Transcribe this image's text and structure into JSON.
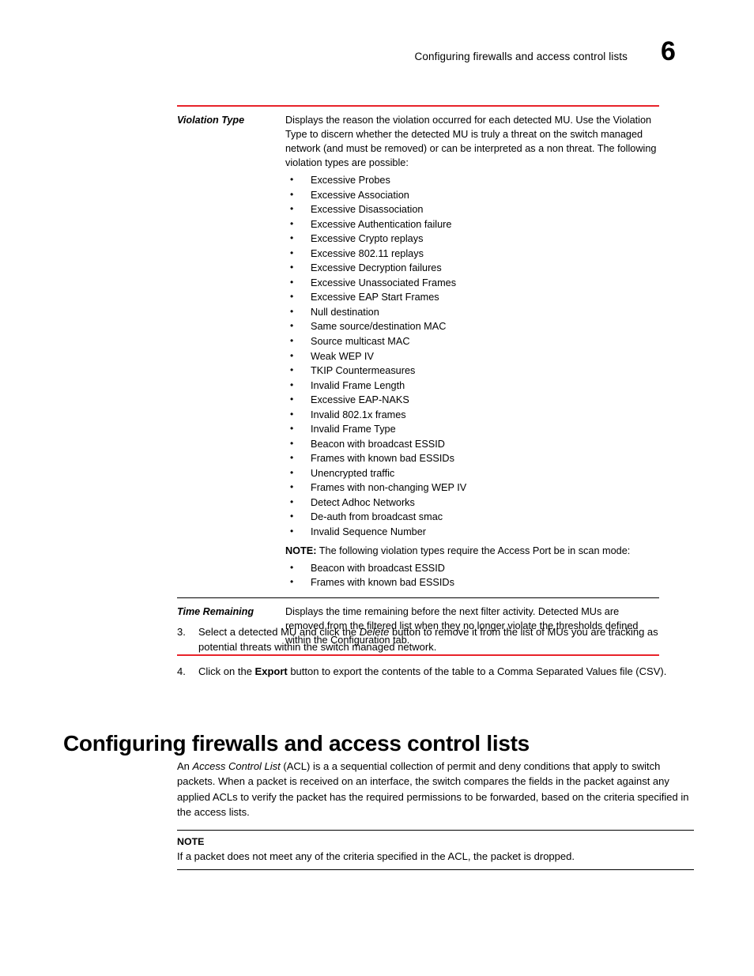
{
  "header": {
    "title": "Configuring firewalls and access control lists",
    "page_number": "6"
  },
  "definition_table": {
    "rows": [
      {
        "term": "Violation Type",
        "description": "Displays the reason the violation occurred for each detected MU. Use the Violation Type to discern whether the detected MU is truly a threat on the switch managed network (and must be removed) or can be interpreted as a non threat. The following violation types are possible:",
        "bullets": [
          "Excessive Probes",
          "Excessive Association",
          "Excessive Disassociation",
          "Excessive Authentication failure",
          "Excessive Crypto replays",
          "Excessive 802.11 replays",
          "Excessive Decryption failures",
          "Excessive Unassociated Frames",
          "Excessive EAP Start Frames",
          "Null destination",
          "Same source/destination MAC",
          "Source multicast MAC",
          "Weak WEP IV",
          "TKIP Countermeasures",
          "Invalid Frame Length",
          "Excessive EAP-NAKS",
          "Invalid 802.1x frames",
          "Invalid Frame Type",
          "Beacon with broadcast ESSID",
          "Frames with known bad ESSIDs",
          "Unencrypted traffic",
          "Frames with non-changing WEP IV",
          "Detect Adhoc Networks",
          "De-auth from broadcast smac",
          "Invalid Sequence Number"
        ],
        "note_label": "NOTE:",
        "note_text": "The following violation types require the Access Port be in scan mode:",
        "note_bullets": [
          "Beacon with broadcast ESSID",
          "Frames with known bad ESSIDs"
        ]
      },
      {
        "term": "Time Remaining",
        "description": "Displays the time remaining before the next filter activity. Detected MUs are removed from the filtered list when they no longer violate the thresholds defined within the Configuration tab."
      }
    ]
  },
  "steps": [
    {
      "number": "3.",
      "text_before": "Select a detected MU and click the ",
      "emphasis": "Delete",
      "emphasis_style": "italic",
      "text_after": " button to remove it from the list of MUs you are tracking as potential threats within the switch managed network."
    },
    {
      "number": "4.",
      "text_before": "Click on the ",
      "emphasis": "Export",
      "emphasis_style": "bold",
      "text_after": " button to export the contents of the table to a Comma Separated Values file (CSV)."
    }
  ],
  "section": {
    "heading": "Configuring firewalls and access control lists",
    "intro_before": "An ",
    "intro_emphasis": "Access Control List",
    "intro_after": " (ACL) is a a sequential collection of permit and deny conditions that apply to switch packets. When a packet is received on an interface, the switch compares the fields in the packet against any applied ACLs to verify the packet has the required permissions to be forwarded, based on the criteria specified in the access lists."
  },
  "note_block": {
    "title": "NOTE",
    "text": "If a packet does not meet any of the criteria specified in the ACL, the packet is dropped."
  },
  "colors": {
    "rule_red": "#e8232a",
    "rule_black": "#000000",
    "text": "#000000",
    "background": "#ffffff"
  }
}
